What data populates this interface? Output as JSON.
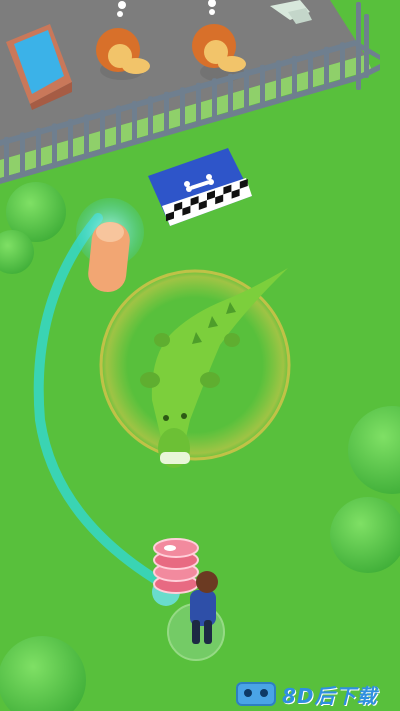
{
  "scene": {
    "name": "zoo-crocodile-enclosure",
    "colors": {
      "grass": "#58c03c",
      "enclosure_floor": "#7d7d7d",
      "fence": "#6f7f8f",
      "crocodile": "#7ccf3c",
      "swipe_trail": "#37d6c0",
      "selection_ring": "#d4c24a",
      "mat": "#2e55c9"
    }
  },
  "tutorial": {
    "hint_icon": "finger-swipe-icon"
  },
  "player": {
    "carrying_icon": "meat-stack-icon",
    "meat_count": 4
  },
  "animals": [
    {
      "name": "lion",
      "icon": "lion-icon"
    },
    {
      "name": "lion",
      "icon": "lion-icon"
    },
    {
      "name": "crocodile",
      "icon": "crocodile-icon"
    }
  ],
  "feeding_mat": {
    "icon": "bone-icon"
  },
  "watermark": {
    "text": "8D后下载",
    "logo_icon": "robot-logo-icon"
  }
}
